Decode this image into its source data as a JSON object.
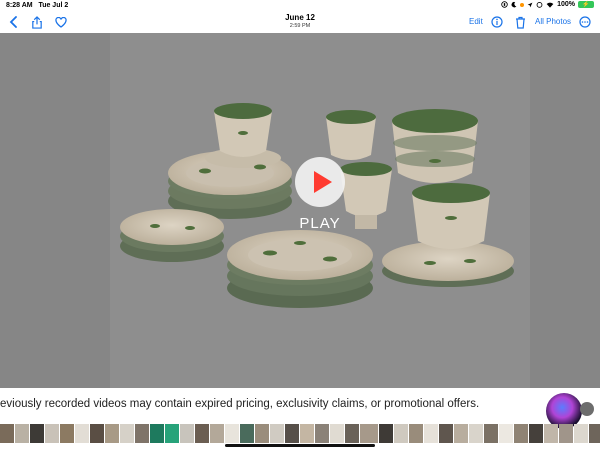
{
  "status_bar": {
    "time": "8:28 AM",
    "date": "Tue Jul 2",
    "battery": "100%"
  },
  "nav": {
    "date": "June 12",
    "clock": "2:59 PM",
    "edit_label": "Edit",
    "all_photos_label": "All Photos"
  },
  "player": {
    "play_label": "PLAY"
  },
  "caption": "eviously recorded videos may contain expired pricing, exclusivity claims, or promotional offers.",
  "colors": {
    "accent": "#1a73e8",
    "play_arrow": "#ff3b30"
  },
  "thumbnails": [
    "#7a6b5a",
    "#b9b1a4",
    "#3d3a36",
    "#c9c2b8",
    "#8c7a62",
    "#e2ddd5",
    "#5a4e44",
    "#a89a86",
    "#d6d1c8",
    "#7f7469",
    "#1e7a5e",
    "#27a37a",
    "#c8c4bc",
    "#6b5e52",
    "#b3a899",
    "#e8e4dc",
    "#4a6b5c",
    "#9a8d7c",
    "#d0cbc2",
    "#57504a",
    "#c4b6a3",
    "#8b8278",
    "#e0dbd2",
    "#6a6259",
    "#a6998a",
    "#3e3a36",
    "#cfc9bf",
    "#998c7b",
    "#e6e1d9",
    "#5f564e",
    "#b8ad9e",
    "#d9d4cb",
    "#7b7165",
    "#ece8e1",
    "#8f8374",
    "#45403b",
    "#c0b6a9",
    "#a0958a",
    "#dcd7ce",
    "#6e655b"
  ]
}
